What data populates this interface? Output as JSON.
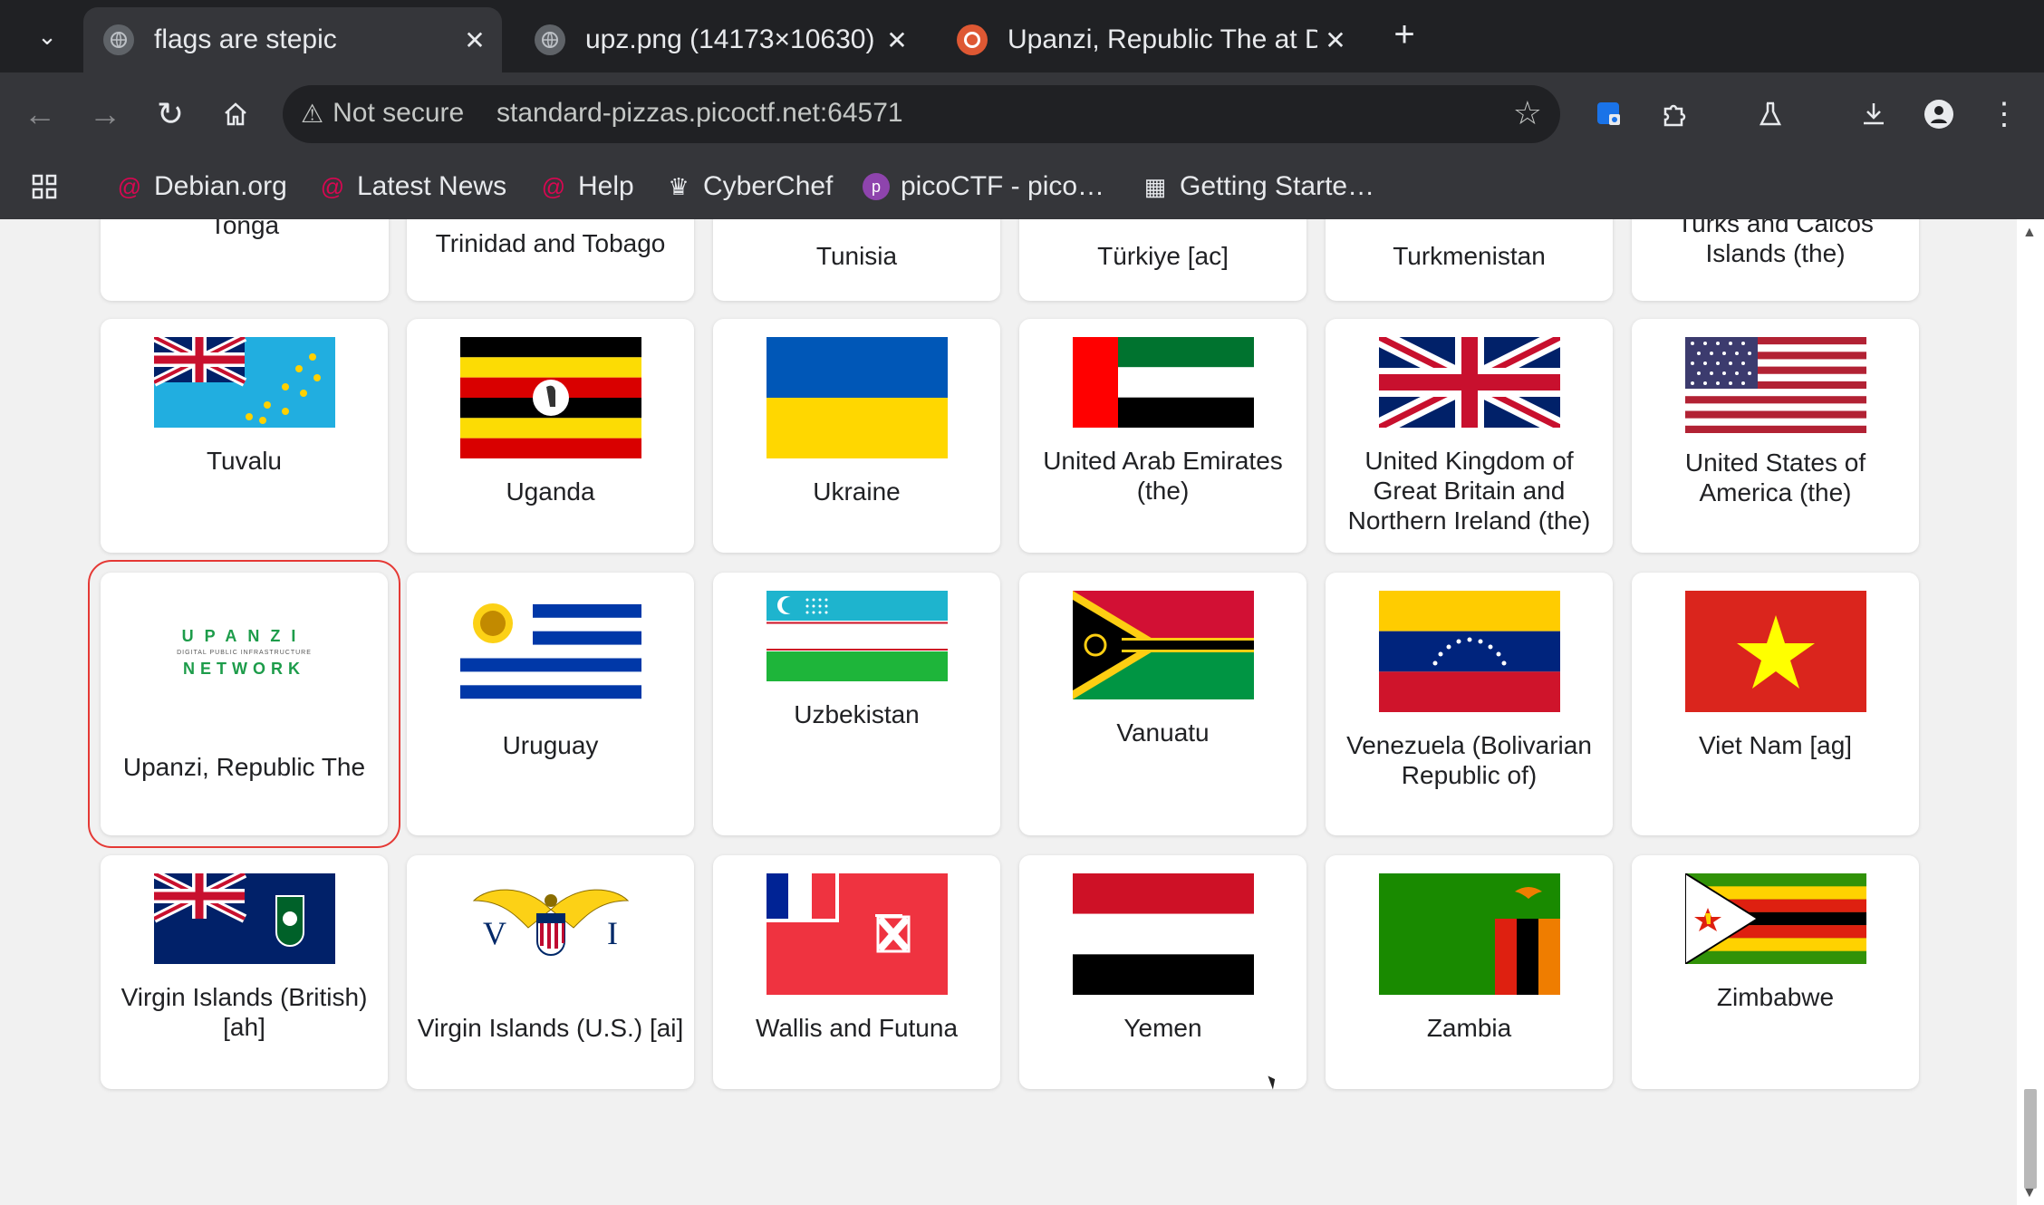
{
  "browser": {
    "tabs": [
      {
        "title": "flags are stepic",
        "active": true
      },
      {
        "title": "upz.png (14173×10630)",
        "active": false
      },
      {
        "title": "Upanzi, Republic The at D",
        "active": false
      }
    ],
    "security_label": "Not secure",
    "url": "standard-pizzas.picoctf.net:64571",
    "bookmarks": [
      "Debian.org",
      "Latest News",
      "Help",
      "CyberChef",
      "picoCTF - pico…",
      "Getting Starte…"
    ]
  },
  "countries": [
    {
      "name": "Tonga",
      "icon": "tonga-flag"
    },
    {
      "name": "Trinidad and Tobago",
      "icon": "trinidad-tobago-flag"
    },
    {
      "name": "Tunisia",
      "icon": "tunisia-flag"
    },
    {
      "name": "Türkiye [ac]",
      "icon": "turkiye-flag"
    },
    {
      "name": "Turkmenistan",
      "icon": "turkmenistan-flag"
    },
    {
      "name": "Turks and Caicos Islands (the)",
      "icon": "turks-caicos-flag"
    },
    {
      "name": "Tuvalu",
      "icon": "tuvalu-flag"
    },
    {
      "name": "Uganda",
      "icon": "uganda-flag"
    },
    {
      "name": "Ukraine",
      "icon": "ukraine-flag"
    },
    {
      "name": "United Arab Emirates (the)",
      "icon": "uae-flag"
    },
    {
      "name": "United Kingdom of Great Britain and Northern Ireland (the)",
      "icon": "uk-flag"
    },
    {
      "name": "United States of America (the)",
      "icon": "usa-flag"
    },
    {
      "name": "Upanzi, Republic The",
      "icon": "upanzi-logo",
      "selected": true
    },
    {
      "name": "Uruguay",
      "icon": "uruguay-flag"
    },
    {
      "name": "Uzbekistan",
      "icon": "uzbekistan-flag"
    },
    {
      "name": "Vanuatu",
      "icon": "vanuatu-flag"
    },
    {
      "name": "Venezuela (Bolivarian Republic of)",
      "icon": "venezuela-flag"
    },
    {
      "name": "Viet Nam [ag]",
      "icon": "vietnam-flag"
    },
    {
      "name": "Virgin Islands (British) [ah]",
      "icon": "bvi-flag"
    },
    {
      "name": "Virgin Islands (U.S.) [ai]",
      "icon": "usvi-flag"
    },
    {
      "name": "Wallis and Futuna",
      "icon": "wallis-futuna-flag"
    },
    {
      "name": "Yemen",
      "icon": "yemen-flag"
    },
    {
      "name": "Zambia",
      "icon": "zambia-flag"
    },
    {
      "name": "Zimbabwe",
      "icon": "zimbabwe-flag"
    }
  ],
  "upanzi_logo": {
    "line1": "UPANZI",
    "line2": "DIGITAL PUBLIC INFRASTRUCTURE",
    "line3": "NETWORK"
  },
  "colors": {
    "selected_outline": "#e53935",
    "chrome_dark": "#202124",
    "chrome_toolbar": "#35363a"
  }
}
